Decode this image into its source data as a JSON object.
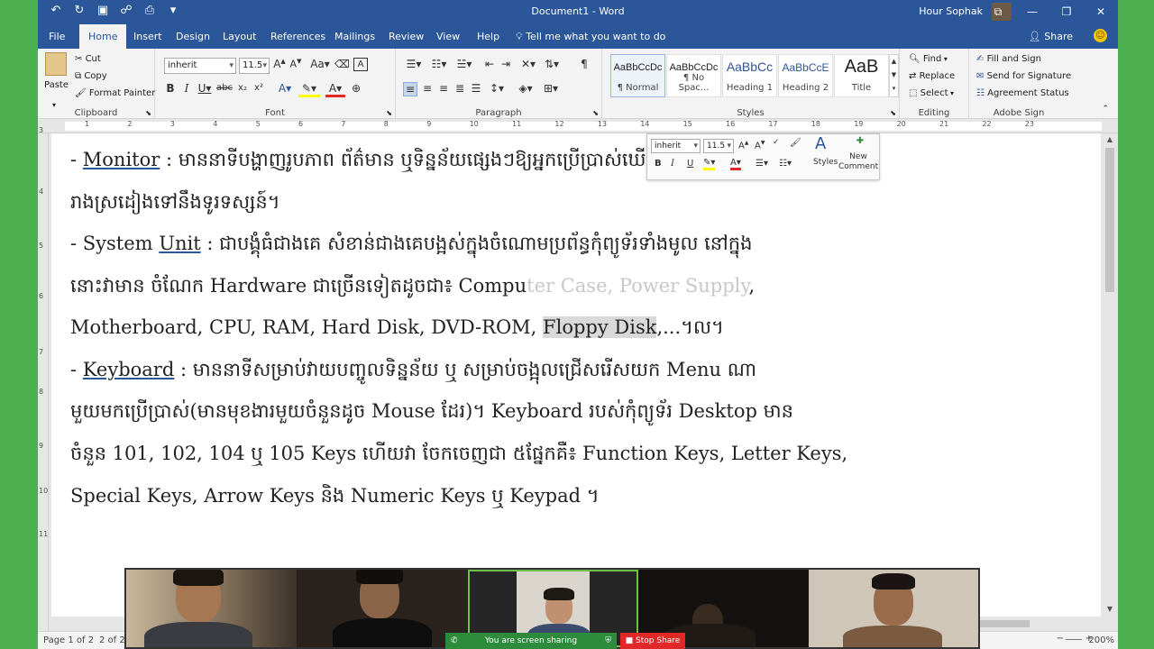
{
  "window": {
    "title": "Document1 - Word",
    "user_name": "Hour Sophak"
  },
  "tabs": [
    {
      "label": "File"
    },
    {
      "label": "Home"
    },
    {
      "label": "Insert"
    },
    {
      "label": "Design"
    },
    {
      "label": "Layout"
    },
    {
      "label": "References"
    },
    {
      "label": "Mailings"
    },
    {
      "label": "Review"
    },
    {
      "label": "View"
    },
    {
      "label": "Help"
    }
  ],
  "tell_me": "Tell me what you want to do",
  "share_label": "Share",
  "ribbon": {
    "clipboard": {
      "paste": "Paste",
      "cut": "Cut",
      "copy": "Copy",
      "format_painter": "Format Painter",
      "label": "Clipboard"
    },
    "font": {
      "name": "inherit",
      "size": "11.5",
      "label": "Font"
    },
    "paragraph": {
      "label": "Paragraph"
    },
    "styles": {
      "label": "Styles",
      "items": [
        {
          "preview": "AaBbCcDc",
          "name": "¶ Normal"
        },
        {
          "preview": "AaBbCcDc",
          "name": "¶ No Spac..."
        },
        {
          "preview": "AaBbCc",
          "name": "Heading 1"
        },
        {
          "preview": "AaBbCcE",
          "name": "Heading 2"
        },
        {
          "preview": "AaB",
          "name": "Title"
        }
      ]
    },
    "editing": {
      "find": "Find",
      "replace": "Replace",
      "select": "Select",
      "label": "Editing"
    },
    "adobe_sign": {
      "fill_sign": "Fill and Sign",
      "send_signature": "Send for Signature",
      "agreement_status": "Agreement Status",
      "label": "Adobe Sign"
    }
  },
  "document": {
    "p1_term": "Monitor",
    "p1_l1_text": " : មាននាទីបង្ហាញរូបភាព ព័ត៌មាន ឬទិន្នន័យផ្សេងៗឱ្យអ្នកប្រើប្រាស់ឃើញ វាមានរូប",
    "p1_l2": "រាងស្រដៀងទៅនឹងទូរទស្សន៍។",
    "p2_term": "System Unit",
    "p2_l1_text": " : ជាបង្គុំធំជាងគេ សំខាន់ជាងគេបង្អស់ក្នុងចំណោមប្រព័ន្ធកុំព្យូទ័រទាំងមូល នៅក្នុង",
    "p2_l2_a": "នោះវាមាន ចំណែក Hardware ជាច្រើនទៀតដូចជា៖ Compu",
    "p2_l2_ghost": "ter Case, Power Supply",
    "p2_l2_b": ",",
    "p2_l3_a": "Motherboard, CPU, RAM, Hard Disk, DVD-ROM, ",
    "p2_l3_hl": "Floppy Disk",
    "p2_l3_b": ",...។ល។",
    "p3_term": "Keyboard",
    "p3_l1_text": " : មាននាទីសម្រាប់វាយបញ្ចូលទិន្នន័យ ឬ សម្រាប់ចង្អុលជ្រើសរើសយក Menu ណា",
    "p3_l2": "មួយមកប្រើប្រាស់(មានមុខងារមួយចំនួនដូច Mouse ដែរ)។ Keyboard របស់កុំព្យូទ័រ Desktop មាន",
    "p3_l3": "ចំនួន 101, 102, 104 ឬ 105 Keys ហើយវា ចែកចេញជា ៥ផ្នែកគឺ៖ Function Keys, Letter Keys,",
    "p3_l4": "Special Keys, Arrow Keys និង Numeric Keys ឬ Keypad ។"
  },
  "mini_toolbar": {
    "font": "inherit",
    "size": "11.5",
    "styles": "Styles",
    "new_comment": "New Comment"
  },
  "status": {
    "page": "Page 1 of 2",
    "words": "2 of 22",
    "zoom": "200%"
  },
  "meeting": {
    "sharing_text": "You are screen sharing",
    "stop_share": "Stop Share"
  },
  "ruler_ticks": [
    "1",
    "2",
    "3",
    "4",
    "5",
    "6",
    "7",
    "8",
    "9",
    "10",
    "11",
    "12",
    "13",
    "14",
    "15",
    "16",
    "17",
    "18",
    "19",
    "20",
    "21",
    "22",
    "23"
  ],
  "colors": {
    "word_blue": "#2b579a",
    "desktop_green": "#4caf50",
    "share_green": "#2d8c3c",
    "stop_red": "#e02828"
  }
}
